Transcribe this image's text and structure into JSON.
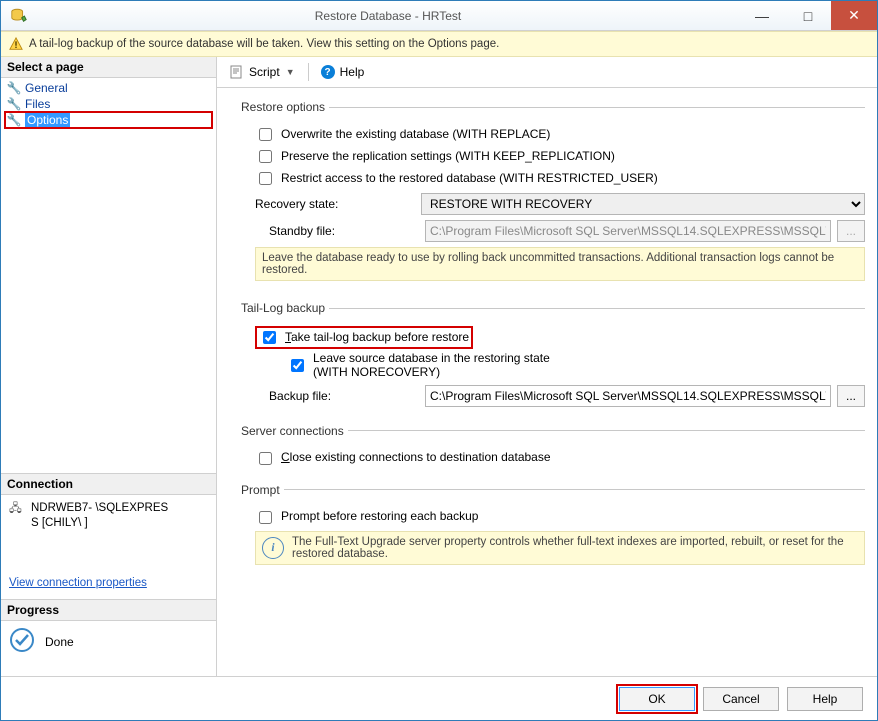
{
  "window": {
    "title": "Restore Database - HRTest",
    "min": "—",
    "max": "□",
    "close": "✕"
  },
  "warning": "A tail-log backup of the source database will be taken. View this setting on the Options page.",
  "sidebar": {
    "select_header": "Select a page",
    "pages": {
      "general": "General",
      "files": "Files",
      "options": "Options"
    },
    "connection_header": "Connection",
    "connection_text_line1": "NDRWEB7-          \\SQLEXPRES",
    "connection_text_line2": "S [CHILY\\            ]",
    "connection_link": "View connection properties",
    "progress_header": "Progress",
    "progress_text": "Done"
  },
  "toolbar": {
    "script": "Script",
    "help": "Help"
  },
  "restore_options": {
    "legend": "Restore options",
    "overwrite": "Overwrite the existing database (WITH REPLACE)",
    "preserve": "Preserve the replication settings (WITH KEEP_REPLICATION)",
    "restrict": "Restrict access to the restored database (WITH RESTRICTED_USER)",
    "recovery_state_label": "Recovery state:",
    "recovery_state_value": "RESTORE WITH RECOVERY",
    "standby_label": "Standby file:",
    "standby_value": "C:\\Program Files\\Microsoft SQL Server\\MSSQL14.SQLEXPRESS\\MSSQL\\B",
    "info": "Leave the database ready to use by rolling back uncommitted transactions. Additional transaction logs cannot be restored."
  },
  "tail_log": {
    "legend": "Tail-Log backup",
    "take_label_pre": "T",
    "take_label_post": "ake tail-log backup before restore",
    "leave_label": "Leave source database in the restoring state\n(WITH NORECOVERY)",
    "backup_label_pre": "B",
    "backup_label_post": "ackup file:",
    "backup_value": "C:\\Program Files\\Microsoft SQL Server\\MSSQL14.SQLEXPRESS\\MSSQL\\B"
  },
  "server_conn": {
    "legend": "Server connections",
    "close_label_pre": "C",
    "close_label_post": "lose existing connections to destination database"
  },
  "prompt": {
    "legend": "Prompt",
    "prompt_label": "Prompt before restoring each backup",
    "info": "The Full-Text Upgrade server property controls whether full-text indexes are imported, rebuilt, or reset for the restored database."
  },
  "footer": {
    "ok": "OK",
    "cancel": "Cancel",
    "help": "Help"
  }
}
